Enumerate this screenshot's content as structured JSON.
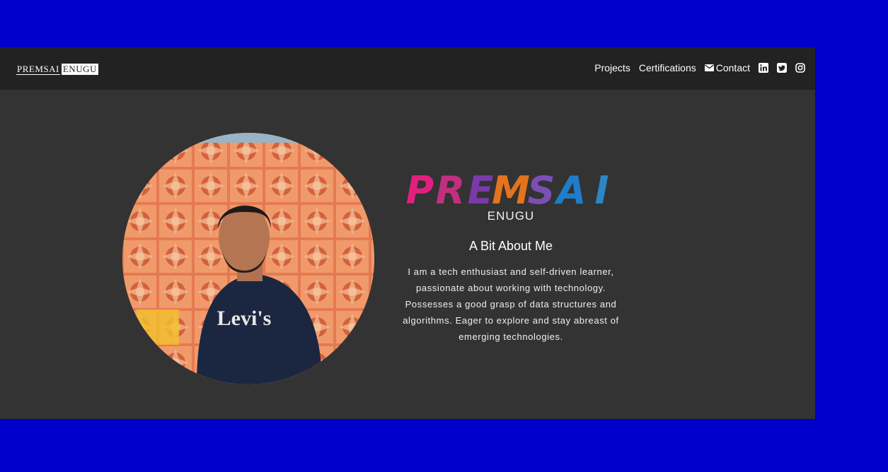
{
  "colors": {
    "page_background": "#0000cc",
    "navbar_background": "#222222",
    "content_background": "#333333",
    "text": "#ffffff"
  },
  "navbar": {
    "brand_first": "PREMSAI",
    "brand_last": "ENUGU",
    "links": {
      "projects": "Projects",
      "certifications": "Certifications",
      "contact": "Contact"
    },
    "icons": {
      "contact": "envelope-icon",
      "linkedin": "linkedin-icon",
      "twitter": "twitter-icon",
      "instagram": "instagram-icon"
    }
  },
  "hero": {
    "photo": "profile-photo",
    "title_letters": [
      {
        "char": "P",
        "color": "#e0207f"
      },
      {
        "char": "R",
        "color": "#c0307f"
      },
      {
        "char": "E",
        "color": "#7a3aa8"
      },
      {
        "char": "M",
        "color": "#e4731e"
      },
      {
        "char": "S",
        "color": "#7b4fb6"
      },
      {
        "char": "A",
        "color": "#1f7cc9"
      },
      {
        "char": "I",
        "color": "#2a86c4"
      }
    ],
    "subtitle": "ENUGU",
    "about_heading": "A Bit About Me",
    "about_text": "I am a tech enthusiast and self-driven learner, passionate about working with technology. Possesses a good grasp of data structures and algorithms. Eager to explore and stay abreast of emerging technologies."
  }
}
